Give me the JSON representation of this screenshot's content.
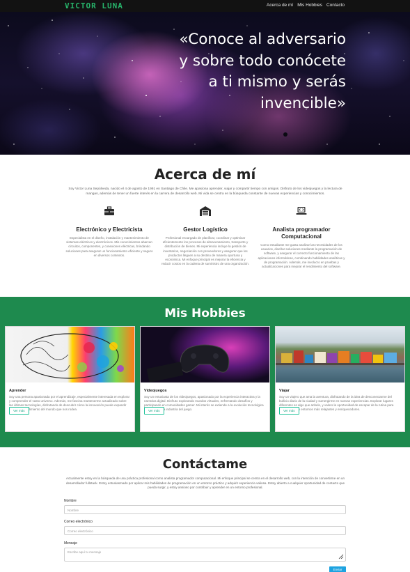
{
  "nav": {
    "brand": "VICTOR LUNA",
    "links": [
      "Acerca de mí",
      "Mis Hobbies",
      "Contacto"
    ]
  },
  "hero": {
    "quote": "«Conoce al adversario y sobre todo conócete a ti mismo y serás invencible»"
  },
  "about": {
    "title": "Acerca de mí",
    "text": "Soy Victor Luna Sepúlveda, nacido el 4 de agosto de 1991 en Santiago de Chile. Me apasiona aprender, viajar y compartir tiempo con amigos. Disfruto de los videojuegos y la lectura de mangas, además de tener un fuerte interés en la carrera de desarrollo web. Mi vida se centra en la búsqueda constante de nuevas experiencias y conocimientos.",
    "skills": [
      {
        "icon": "toolbox-icon",
        "title": "Electrónico y Electricista",
        "text": "Especialista en el diseño, instalación y mantenimiento de sistemas eléctricos y electrónicos. Mis conocimientos abarcan circuitos, componentes, y conexiones eléctricas, brindando soluciones para asegurar un funcionamiento eficiente y seguro en diversos contextos."
      },
      {
        "icon": "warehouse-icon",
        "title": "Gestor Logístico",
        "text": "Profesional encargado de planificar, coordinar y optimizar eficientemente los procesos de almacenamiento, transporte y distribución de bienes. Mi experiencia incluye la gestión de inventarios, negociación con proveedores y asegurar que los productos lleguen a su destino de manera oportuna y económica. Mi enfoque principal es mejorar la eficiencia y reducir costos en la cadena de suministro de una organización."
      },
      {
        "icon": "laptop-code-icon",
        "title": "Analista programador Computacional",
        "text": "Como estudiante me gusta analizar las necesidades de los usuarios, diseñar soluciones mediante la programación de software, y asegurar el correcto funcionamiento de las aplicaciones informáticas, combinando habilidades analíticas y de programación. Además, me involucro en pruebas y actualizaciones para mejorar el rendimiento del software."
      }
    ]
  },
  "hobbies": {
    "title": "Mis Hobbies",
    "cards": [
      {
        "image": "brain-art-image",
        "title": "Aprender",
        "text": "Soy una persona apasionada por el aprendizaje, especialmente interesada en explorar y comprender el vasto universo. Además, me fascina mantenerme actualizado sobre las últimas tecnologías, disfrutando de descubrir cómo la innovación puede expandir nuestro entendimiento del mundo que nos rodea.",
        "button": "Ver más"
      },
      {
        "image": "gamepad-image",
        "title": "Videojuegos",
        "text": "Soy un entusiasta de los videojuegos, apasionado por la experiencia interactiva y la narrativa digital. Disfruto explorando mundos virtuales, enfrentando desafíos y participando en comunidades gamer. Mi interés se extiende a la evolución tecnológica y creativa de la industria del juego.",
        "button": "Ver más"
      },
      {
        "image": "palafitos-image",
        "title": "Viajar",
        "text": "Soy un viajero que ama la aventura, disfrutando de la idea de desconectarme del bullicio diario de la ciudad y sumergirme en nuevas experiencias. Explorar lugares diferentes es algo que anhelo, y valoro la oportunidad de escapar de la rutina para sumergirme en entornos más relajantes y enriquecedores.",
        "button": "Ver más"
      }
    ]
  },
  "contact": {
    "title": "Contáctame",
    "text": "Actualmente estoy en la búsqueda de una práctica profesional como analista programador computacional. Mi enfoque principal se centra en el desarrollo web, con la intención de convertirme en un desarrollador fullstack. Estoy entusiasmado por aplicar mis habilidades de programación en un entorno práctico y adquirir experiencia valiosa. Estoy abierto a cualquier oportunidad de contacto que pueda surgir, y estoy ansioso por contribuir y aprender en un entorno profesional.",
    "name_label": "Nombre",
    "name_placeholder": "Nombre",
    "email_label": "Correo electrónico",
    "email_placeholder": "Correo electrónico",
    "message_label": "Mensaje",
    "message_placeholder": "Escribe aquí tu mensaje",
    "send_label": "Enviar"
  },
  "colors": {
    "nav_bg": "#121212",
    "brand": "#27b36a",
    "hobbies_bg": "#1e8a4e",
    "button_border": "#20c29a",
    "send_bg": "#1ea3e0"
  }
}
